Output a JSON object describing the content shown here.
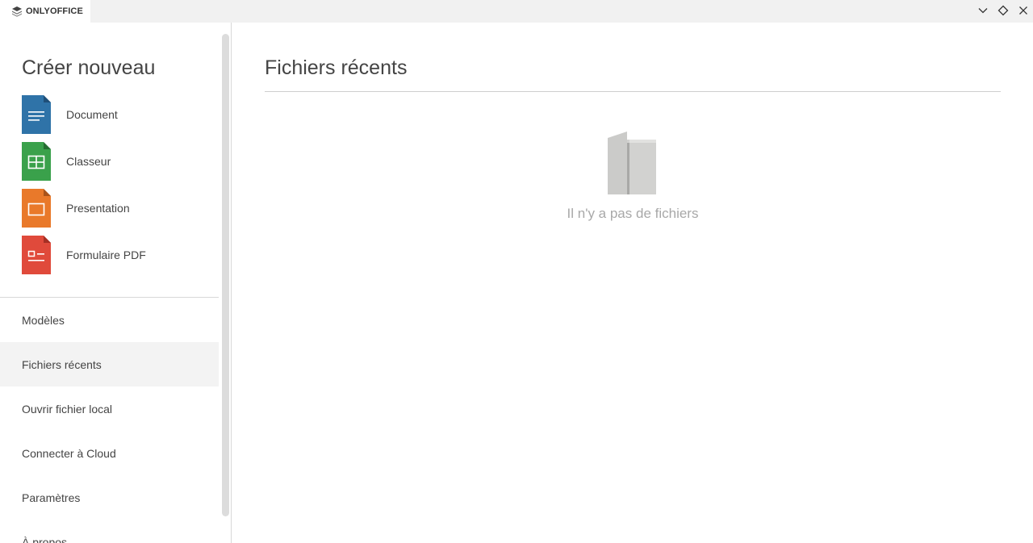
{
  "titlebar": {
    "app_name": "ONLYOFFICE",
    "controls": [
      "minimize-icon",
      "restore-icon",
      "close-icon"
    ]
  },
  "sidebar": {
    "create_title": "Créer nouveau",
    "create_items": [
      {
        "label": "Document",
        "icon": "document-icon",
        "color": "#2f73a8"
      },
      {
        "label": "Classeur",
        "icon": "spreadsheet-icon",
        "color": "#3aa14b"
      },
      {
        "label": "Presentation",
        "icon": "presentation-icon",
        "color": "#e9792a"
      },
      {
        "label": "Formulaire PDF",
        "icon": "pdf-form-icon",
        "color": "#e04a3b"
      }
    ],
    "nav_items": [
      {
        "label": "Modèles"
      },
      {
        "label": "Fichiers récents",
        "active": true
      },
      {
        "label": "Ouvrir fichier local"
      },
      {
        "label": "Connecter à Cloud"
      },
      {
        "label": "Paramètres"
      },
      {
        "label": "À propos"
      }
    ]
  },
  "main": {
    "title": "Fichiers récents",
    "empty_text": "Il n'y a pas de fichiers",
    "empty_icon": "empty-folder-icon"
  }
}
